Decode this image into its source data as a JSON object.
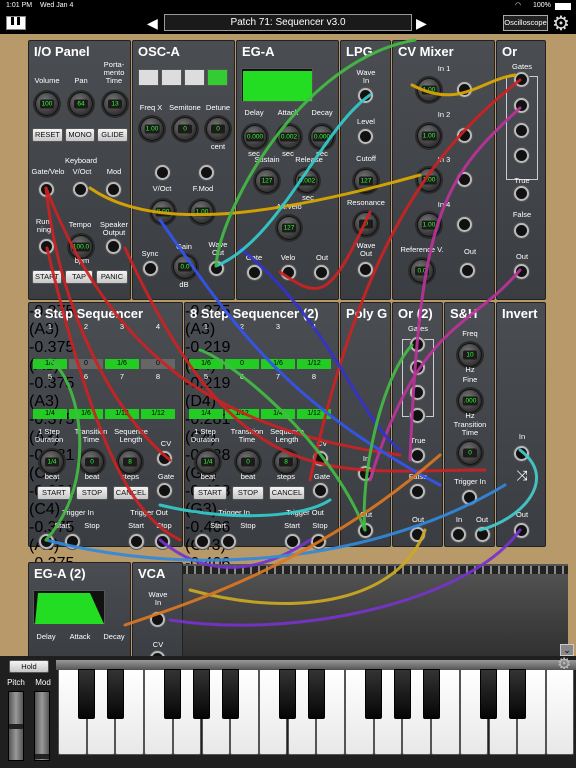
{
  "status": {
    "time": "1:01 PM",
    "date": "Wed Jan 4",
    "battery": "100%"
  },
  "header": {
    "patch_title": "Patch 71: Sequencer v3.0",
    "oscilloscope_label": "Oscilloscope"
  },
  "modules": {
    "io": {
      "title": "I/O Panel",
      "volume": "Volume",
      "pan": "Pan",
      "portamento": "Porta-\nmento\nTime",
      "vol_val": "100",
      "pan_val": "64",
      "porta_val": "13",
      "reset": "RESET",
      "mono": "MONO",
      "glide": "GLIDE",
      "keyboard": "Keyboard",
      "gate_velo": "Gate/Velo",
      "voct": "V/Oct",
      "mod": "Mod",
      "running": "Run-\nning",
      "tempo": "Tempo",
      "tempo_val": "100.0",
      "bpm": "bpm",
      "speaker": "Speaker\nOutput",
      "start": "START",
      "tap": "TAP",
      "panic": "PANIC"
    },
    "osc": {
      "title": "OSC-A",
      "freqx": "Freq X",
      "semitone": "Semitone",
      "detune": "Detune",
      "fx_val": "1.00",
      "semi_val": "0",
      "det_val": "0",
      "cent": "cent",
      "voct": "V/Oct",
      "fmod": "F.Mod",
      "voct_val": "0.00",
      "fmod_val": "1.00",
      "sync": "Sync",
      "gain": "Gain",
      "gain_val": "0.0",
      "db": "dB",
      "wave_out": "Wave\nOut"
    },
    "ega": {
      "title": "EG-A",
      "delay": "Delay",
      "attack": "Attack",
      "decay": "Decay",
      "d_val": "0.000",
      "a_val": "0.002",
      "dc_val": "0.000",
      "sec": "sec",
      "sustain": "Sustain",
      "release": "Release",
      "s_val": "127",
      "r_val": "0.002",
      "altvelo": "Alt.Velo",
      "av_val": "127",
      "gate": "Gate",
      "velo": "Velo",
      "out": "Out"
    },
    "lpg": {
      "title": "LPG",
      "wave_in": "Wave\nIn",
      "level": "Level",
      "cutoff": "Cutoff",
      "cutoff_val": "127",
      "resonance": "Resonance",
      "res_val": "0",
      "wave_out": "Wave\nOut"
    },
    "cvmix": {
      "title": "CV Mixer",
      "in1": "In 1",
      "in2": "In 2",
      "in3": "In 3",
      "in4": "In 4",
      "v1": "1.00",
      "v2": "1.00",
      "v3": "1.00",
      "v4": "1.00",
      "ref": "Reference V.",
      "ref_val": "0.0",
      "out": "Out"
    },
    "or1": {
      "title": "Or",
      "gates": "Gates",
      "true": "True",
      "false": "False",
      "out": "Out"
    },
    "seq1": {
      "title": "8 Step Sequencer",
      "n": [
        "1",
        "2",
        "3",
        "4",
        "5",
        "6",
        "7",
        "8"
      ],
      "vals": [
        "-0.375",
        "-0.375",
        "-0.375",
        "-0.375",
        "-0.281",
        "-0.281",
        "-0.375",
        "-0.375"
      ],
      "notes": [
        "(A3)",
        "(A3)",
        "(A3)",
        "(A3)",
        "(C4)",
        "(C4)",
        "(A3)",
        "(A3)"
      ],
      "g1": [
        "1/6",
        "0",
        "1/6",
        "0"
      ],
      "g2": [
        "1/4",
        "1/6",
        "1/12",
        "1/12"
      ],
      "step_dur": "1 Step\nDuration",
      "trans": "Transition\nTime",
      "seq_len": "Sequence\nLength",
      "dur_val": "1/4",
      "trans_val": "0",
      "len_val": "8",
      "beat": "beat",
      "steps": "steps",
      "cv": "CV",
      "gate": "Gate",
      "start": "START",
      "stop": "STOP",
      "cancel": "CANCEL",
      "trig_in": "Trigger In",
      "trig_out": "Trigger Out",
      "start_l": "Start",
      "stop_l": "Stop"
    },
    "seq2": {
      "title": "8 Step Sequencer (2)",
      "vals": [
        "-0.375",
        "-0.219",
        "-0.219",
        "-0.281",
        "-0.438",
        "-0.438",
        "-0.406",
        "-0.406"
      ],
      "notes": [
        "(A3)",
        "(D4)",
        "(D4)",
        "(C4)",
        "(G3)",
        "(G3)",
        "(G#3)",
        "(G#3)"
      ],
      "g1": [
        "1/6",
        "0",
        "1/6",
        "1/12"
      ],
      "g2": [
        "1/4",
        "1/12",
        "1/4",
        "1/12"
      ]
    },
    "polyg": {
      "title": "Poly G",
      "in": "In",
      "out": "Out"
    },
    "or2": {
      "title": "Or (2)",
      "gates": "Gates",
      "true": "True",
      "false": "False",
      "out": "Out"
    },
    "sh": {
      "title": "S&H",
      "freq": "Freq",
      "freq_val": "10",
      "hz": "Hz",
      "fine": "Fine",
      "fine_val": ".000",
      "trans": "Transition\nTime",
      "trans_val": "0",
      "trig": "Trigger In",
      "in": "In",
      "out": "Out"
    },
    "invert": {
      "title": "Invert",
      "in": "In",
      "out": "Out"
    },
    "ega2": {
      "title": "EG-A (2)",
      "delay": "Delay",
      "attack": "Attack",
      "decay": "Decay"
    },
    "vca": {
      "title": "VCA",
      "wave_in": "Wave\nIn",
      "cv": "CV"
    }
  },
  "keyboard": {
    "hold": "Hold",
    "pitch": "Pitch",
    "mod": "Mod"
  },
  "colors": {
    "panel": "#3f4247",
    "wood": "#b89a6a",
    "led": "#33ff33",
    "env_green": "#22dd22"
  }
}
